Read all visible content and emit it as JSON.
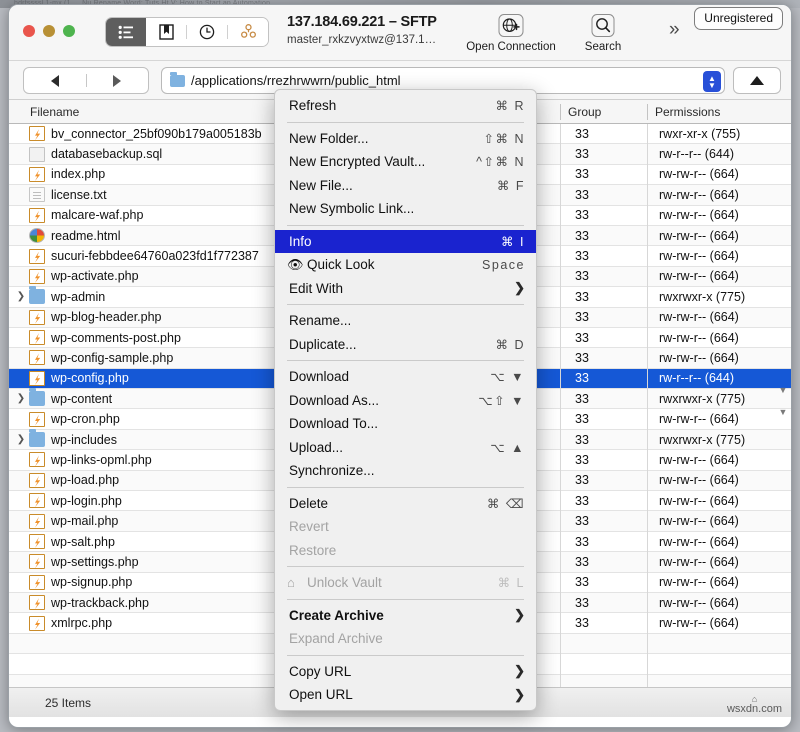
{
  "desktop": {
    "ghost_text": "hdrfssssl 1-mx   (1  …  Nu   Rename   Word: Tuts Ht   V:   How to Start an Automation"
  },
  "window": {
    "traffic_lights": [
      "close",
      "minimize",
      "zoom"
    ],
    "toolbar": {
      "segmented": [
        {
          "name": "browser-view",
          "icon": "list-view-icon",
          "active": true
        },
        {
          "name": "bookmarks-view",
          "icon": "bookmark-icon",
          "active": false
        },
        {
          "name": "history-view",
          "icon": "clock-icon",
          "active": false
        },
        {
          "name": "bonjour-view",
          "icon": "bonjour-icon",
          "active": false
        }
      ],
      "connection_title": "137.184.69.221 – SFTP",
      "connection_subtitle": "master_rxkzvyxtwz@137.1…",
      "open_connection_label": "Open Connection",
      "search_label": "Search",
      "overflow_glyph": "»",
      "unregistered_badge": "Unregistered"
    },
    "pathbar": {
      "back_label": "◀",
      "forward_label": "▶",
      "path_value": "/applications/rrezhrwwrn/public_html",
      "stepper_up": "▲",
      "stepper_down": "▼",
      "up_button": "▲"
    },
    "columns": {
      "filename": "Filename",
      "group": "Group",
      "permissions": "Permissions"
    },
    "statusbar": {
      "items_count": "25 Items"
    },
    "watermark": "wsxdn.com"
  },
  "files": [
    {
      "name": "bv_connector_25bf090b179a005183b",
      "icon": "php-file-icon",
      "group": "33",
      "permissions": "rwxr-xr-x (755)",
      "expandable": false,
      "selected": false
    },
    {
      "name": "databasebackup.sql",
      "icon": "generic-file-icon",
      "group": "33",
      "permissions": "rw-r--r-- (644)",
      "expandable": false,
      "selected": false
    },
    {
      "name": "index.php",
      "icon": "php-file-icon",
      "group": "33",
      "permissions": "rw-rw-r-- (664)",
      "expandable": false,
      "selected": false
    },
    {
      "name": "license.txt",
      "icon": "text-file-icon",
      "group": "33",
      "permissions": "rw-rw-r-- (664)",
      "expandable": false,
      "selected": false
    },
    {
      "name": "malcare-waf.php",
      "icon": "php-file-icon",
      "group": "33",
      "permissions": "rw-rw-r-- (664)",
      "expandable": false,
      "selected": false
    },
    {
      "name": "readme.html",
      "icon": "html-file-icon",
      "group": "33",
      "permissions": "rw-rw-r-- (664)",
      "expandable": false,
      "selected": false
    },
    {
      "name": "sucuri-febbdee64760a023fd1f772387",
      "icon": "php-file-icon",
      "group": "33",
      "permissions": "rw-rw-r-- (664)",
      "expandable": false,
      "selected": false
    },
    {
      "name": "wp-activate.php",
      "icon": "php-file-icon",
      "group": "33",
      "permissions": "rw-rw-r-- (664)",
      "expandable": false,
      "selected": false
    },
    {
      "name": "wp-admin",
      "icon": "folder-icon",
      "group": "33",
      "permissions": "rwxrwxr-x (775)",
      "expandable": true,
      "selected": false
    },
    {
      "name": "wp-blog-header.php",
      "icon": "php-file-icon",
      "group": "33",
      "permissions": "rw-rw-r-- (664)",
      "expandable": false,
      "selected": false
    },
    {
      "name": "wp-comments-post.php",
      "icon": "php-file-icon",
      "group": "33",
      "permissions": "rw-rw-r-- (664)",
      "expandable": false,
      "selected": false
    },
    {
      "name": "wp-config-sample.php",
      "icon": "php-file-icon",
      "group": "33",
      "permissions": "rw-rw-r-- (664)",
      "expandable": false,
      "selected": false
    },
    {
      "name": "wp-config.php",
      "icon": "php-file-icon",
      "group": "33",
      "permissions": "rw-r--r-- (644)",
      "expandable": false,
      "selected": true
    },
    {
      "name": "wp-content",
      "icon": "folder-icon",
      "group": "33",
      "permissions": "rwxrwxr-x (775)",
      "expandable": true,
      "selected": false
    },
    {
      "name": "wp-cron.php",
      "icon": "php-file-icon",
      "group": "33",
      "permissions": "rw-rw-r-- (664)",
      "expandable": false,
      "selected": false
    },
    {
      "name": "wp-includes",
      "icon": "folder-icon",
      "group": "33",
      "permissions": "rwxrwxr-x (775)",
      "expandable": true,
      "selected": false
    },
    {
      "name": "wp-links-opml.php",
      "icon": "php-file-icon",
      "group": "33",
      "permissions": "rw-rw-r-- (664)",
      "expandable": false,
      "selected": false
    },
    {
      "name": "wp-load.php",
      "icon": "php-file-icon",
      "group": "33",
      "permissions": "rw-rw-r-- (664)",
      "expandable": false,
      "selected": false
    },
    {
      "name": "wp-login.php",
      "icon": "php-file-icon",
      "group": "33",
      "permissions": "rw-rw-r-- (664)",
      "expandable": false,
      "selected": false
    },
    {
      "name": "wp-mail.php",
      "icon": "php-file-icon",
      "group": "33",
      "permissions": "rw-rw-r-- (664)",
      "expandable": false,
      "selected": false
    },
    {
      "name": "wp-salt.php",
      "icon": "php-file-icon",
      "group": "33",
      "permissions": "rw-rw-r-- (664)",
      "expandable": false,
      "selected": false
    },
    {
      "name": "wp-settings.php",
      "icon": "php-file-icon",
      "group": "33",
      "permissions": "rw-rw-r-- (664)",
      "expandable": false,
      "selected": false
    },
    {
      "name": "wp-signup.php",
      "icon": "php-file-icon",
      "group": "33",
      "permissions": "rw-rw-r-- (664)",
      "expandable": false,
      "selected": false
    },
    {
      "name": "wp-trackback.php",
      "icon": "php-file-icon",
      "group": "33",
      "permissions": "rw-rw-r-- (664)",
      "expandable": false,
      "selected": false
    },
    {
      "name": "xmlrpc.php",
      "icon": "php-file-icon",
      "group": "33",
      "permissions": "rw-rw-r-- (664)",
      "expandable": false,
      "selected": false
    }
  ],
  "context_menu": [
    {
      "type": "item",
      "label": "Refresh",
      "keys": "⌘ R",
      "state": "normal",
      "name": "menu-refresh"
    },
    {
      "type": "separator"
    },
    {
      "type": "item",
      "label": "New Folder...",
      "keys": "⇧⌘ N",
      "state": "normal",
      "name": "menu-new-folder"
    },
    {
      "type": "item",
      "label": "New Encrypted Vault...",
      "keys": "^⇧⌘ N",
      "state": "normal",
      "name": "menu-new-encrypted-vault"
    },
    {
      "type": "item",
      "label": "New File...",
      "keys": "⌘ F",
      "state": "normal",
      "name": "menu-new-file"
    },
    {
      "type": "item",
      "label": "New Symbolic Link...",
      "keys": "",
      "state": "normal",
      "name": "menu-new-symbolic-link"
    },
    {
      "type": "separator"
    },
    {
      "type": "item",
      "label": "Info",
      "keys": "⌘ I",
      "state": "highlight",
      "name": "menu-info"
    },
    {
      "type": "item",
      "label": "Quick Look",
      "keys": "Space",
      "state": "normal",
      "icon": "eye-icon",
      "name": "menu-quick-look"
    },
    {
      "type": "item",
      "label": "Edit With",
      "keys": "",
      "state": "normal",
      "submenu": true,
      "name": "menu-edit-with"
    },
    {
      "type": "separator"
    },
    {
      "type": "item",
      "label": "Rename...",
      "keys": "",
      "state": "normal",
      "name": "menu-rename"
    },
    {
      "type": "item",
      "label": "Duplicate...",
      "keys": "⌘ D",
      "state": "normal",
      "name": "menu-duplicate"
    },
    {
      "type": "separator"
    },
    {
      "type": "item",
      "label": "Download",
      "keys": "⌥ ▼",
      "state": "normal",
      "name": "menu-download"
    },
    {
      "type": "item",
      "label": "Download As...",
      "keys": "⌥⇧ ▼",
      "state": "normal",
      "name": "menu-download-as"
    },
    {
      "type": "item",
      "label": "Download To...",
      "keys": "",
      "state": "normal",
      "name": "menu-download-to"
    },
    {
      "type": "item",
      "label": "Upload...",
      "keys": "⌥ ▲",
      "state": "normal",
      "name": "menu-upload"
    },
    {
      "type": "item",
      "label": "Synchronize...",
      "keys": "",
      "state": "normal",
      "name": "menu-synchronize"
    },
    {
      "type": "separator"
    },
    {
      "type": "item",
      "label": "Delete",
      "keys": "⌘ ⌫",
      "state": "normal",
      "name": "menu-delete"
    },
    {
      "type": "item",
      "label": "Revert",
      "keys": "",
      "state": "disabled",
      "name": "menu-revert"
    },
    {
      "type": "item",
      "label": "Restore",
      "keys": "",
      "state": "disabled",
      "name": "menu-restore"
    },
    {
      "type": "separator"
    },
    {
      "type": "item",
      "label": "Unlock Vault",
      "keys": "⌘ L",
      "state": "disabled",
      "icon": "lock-icon",
      "name": "menu-unlock-vault"
    },
    {
      "type": "separator"
    },
    {
      "type": "item",
      "label": "Create Archive",
      "keys": "",
      "state": "bold",
      "submenu": true,
      "name": "menu-create-archive"
    },
    {
      "type": "item",
      "label": "Expand Archive",
      "keys": "",
      "state": "disabled",
      "name": "menu-expand-archive"
    },
    {
      "type": "separator"
    },
    {
      "type": "item",
      "label": "Copy URL",
      "keys": "",
      "state": "normal",
      "submenu": true,
      "name": "menu-copy-url"
    },
    {
      "type": "item",
      "label": "Open URL",
      "keys": "",
      "state": "normal",
      "submenu": true,
      "name": "menu-open-url"
    }
  ]
}
